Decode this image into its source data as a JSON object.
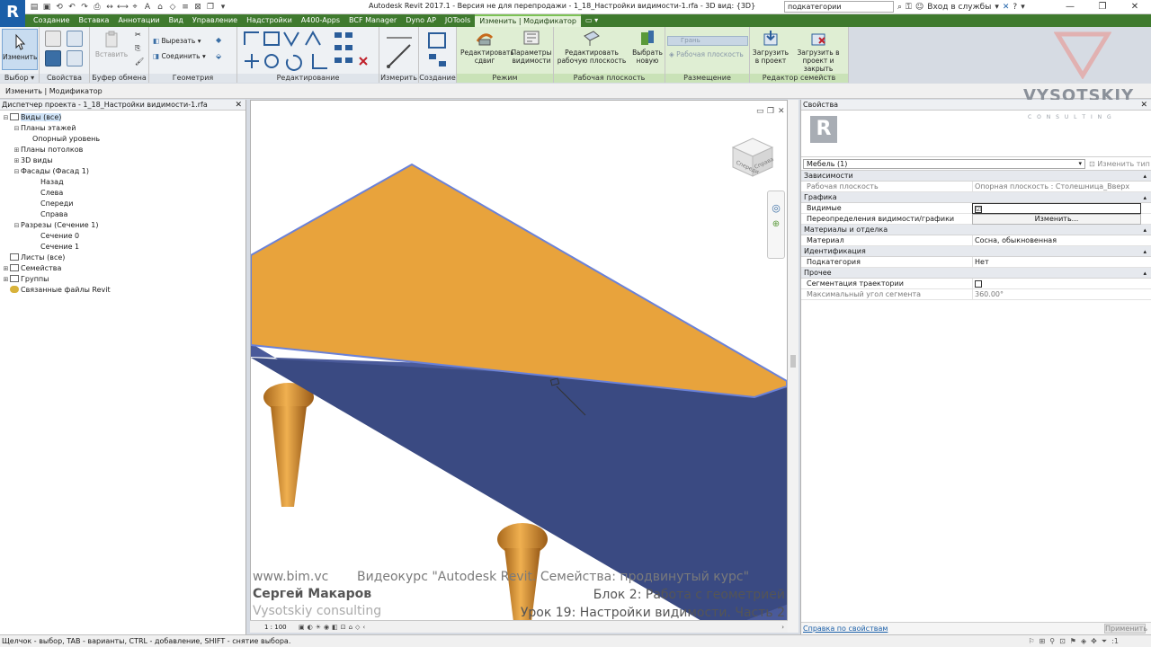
{
  "app": {
    "logo_letter": "R",
    "title": "Autodesk Revit 2017.1 - Версия не для перепродажи -    1_18_Настройки видимости-1.rfa - 3D вид: {3D}",
    "search_value": "подкатегории",
    "login_label": "Вход в службы",
    "window_controls": [
      "—",
      "❐",
      "✕"
    ]
  },
  "tabs": [
    {
      "label": "Создание",
      "active": false
    },
    {
      "label": "Вставка",
      "active": false
    },
    {
      "label": "Аннотации",
      "active": false
    },
    {
      "label": "Вид",
      "active": false
    },
    {
      "label": "Управление",
      "active": false
    },
    {
      "label": "Надстройки",
      "active": false
    },
    {
      "label": "A400-Apps",
      "active": false
    },
    {
      "label": "BCF Manager",
      "active": false
    },
    {
      "label": "Dyno AP",
      "active": false
    },
    {
      "label": "JOTools",
      "active": false
    },
    {
      "label": "Изменить | Модификатор",
      "active": true
    }
  ],
  "ribbon": {
    "modify_label": "Изменить",
    "panels": {
      "select": "Выбор ▾",
      "properties": "Свойства",
      "clipboard": "Буфер обмена",
      "geometry": "Геометрия",
      "modify": "Редактирование",
      "measure": "Измерить",
      "create": "Создание",
      "mode": "Режим",
      "work_plane": "Рабочая плоскость",
      "placement": "Размещение",
      "family_editor": "Редактор семейств"
    },
    "paste_label": "Вставить",
    "cut_label": "Вырезать",
    "join_label": "Соединить",
    "edit_sweep": "Редактировать сдвиг",
    "visibility_params": "Параметры видимости",
    "edit_work_plane": "Редактировать рабочую плоскость",
    "pick_new": "Выбрать новую",
    "face_label": "Грань",
    "work_plane_label": "Рабочая плоскость",
    "load_into_project": "Загрузить в проект",
    "load_and_close": "Загрузить в проект и закрыть"
  },
  "options_bar": {
    "text": "Изменить | Модификатор"
  },
  "browser": {
    "title": "Диспетчер проекта - 1_18_Настройки видимости-1.rfa",
    "items": [
      {
        "label": "Виды (все)",
        "toggle": "⊟",
        "indent": 0,
        "selected": true
      },
      {
        "label": "Планы этажей",
        "toggle": "⊟",
        "indent": 1
      },
      {
        "label": "Опорный уровень",
        "toggle": "",
        "indent": 2
      },
      {
        "label": "Планы потолков",
        "toggle": "⊞",
        "indent": 1
      },
      {
        "label": "3D виды",
        "toggle": "⊞",
        "indent": 1
      },
      {
        "label": "Фасады (Фасад 1)",
        "toggle": "⊟",
        "indent": 1
      },
      {
        "label": "Назад",
        "toggle": "",
        "indent": 2
      },
      {
        "label": "Слева",
        "toggle": "",
        "indent": 2
      },
      {
        "label": "Спереди",
        "toggle": "",
        "indent": 2
      },
      {
        "label": "Справа",
        "toggle": "",
        "indent": 2
      },
      {
        "label": "Разрезы (Сечение 1)",
        "toggle": "⊟",
        "indent": 1
      },
      {
        "label": "Сечение 0",
        "toggle": "",
        "indent": 2
      },
      {
        "label": "Сечение 1",
        "toggle": "",
        "indent": 2
      },
      {
        "label": "Листы (все)",
        "toggle": "",
        "indent": 0
      },
      {
        "label": "Семейства",
        "toggle": "⊞",
        "indent": 0
      },
      {
        "label": "Группы",
        "toggle": "⊞",
        "indent": 0
      },
      {
        "label": "Связанные файлы Revit",
        "toggle": "",
        "indent": 0
      }
    ]
  },
  "viewport": {
    "viewcube_labels": [
      "Спереди",
      "Справа"
    ],
    "scale": "1 : 100",
    "watermark": {
      "line1_left": "www.bim.vc",
      "line1_right": "Видеокурс \"Autodesk Revit. Семейства: продвинутый курс\"",
      "author": "Сергей Макаров",
      "company": "Vysotskiy consulting",
      "block": "Блок 2: Работа с геометрией",
      "lesson": "Урок 19: Настройки видимости. Часть 2"
    },
    "brand": "VYSOTSKIY",
    "brand_sub": "C O N S U L T I N G"
  },
  "properties": {
    "title": "Свойства",
    "type_selector": "Мебель (1)",
    "edit_type": "Изменить тип",
    "groups": [
      {
        "name": "Зависимости",
        "rows": [
          {
            "name": "Рабочая плоскость",
            "value": "Опорная плоскость : Столешница_Вверх",
            "dim": true
          }
        ]
      },
      {
        "name": "Графика",
        "rows": [
          {
            "name": "Видимые",
            "value": "☑",
            "type": "check",
            "checked": true
          },
          {
            "name": "Переопределения видимости/графики",
            "value": "Изменить...",
            "type": "button"
          }
        ]
      },
      {
        "name": "Материалы и отделка",
        "rows": [
          {
            "name": "Материал",
            "value": "Сосна, обыкновенная"
          }
        ]
      },
      {
        "name": "Идентификация",
        "rows": [
          {
            "name": "Подкатегория",
            "value": "Нет"
          }
        ]
      },
      {
        "name": "Прочее",
        "rows": [
          {
            "name": "Сегментация траектории",
            "value": "",
            "type": "check",
            "checked": false
          },
          {
            "name": "Максимальный угол сегмента",
            "value": "360.00°",
            "dim": true
          }
        ]
      }
    ],
    "help_link": "Справка по свойствам",
    "apply_label": "Применить"
  },
  "status": {
    "text": "Щелчок - выбор, TAB - варианты, CTRL - добавление, SHIFT - снятие выбора.",
    "filter_count": ":1"
  },
  "colors": {
    "tab_bar": "#3f7a2e",
    "context_ribbon": "#dfeed3",
    "table_top": "#e8a33c",
    "table_edge": "#4a5a9a",
    "revit_blue": "#1b5fa8"
  }
}
